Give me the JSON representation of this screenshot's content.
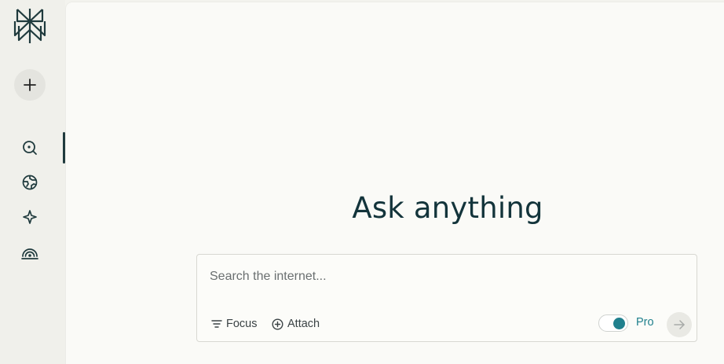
{
  "sidebar": {
    "logo_icon": "perplexity-logo-icon",
    "new_thread_icon": "plus-icon",
    "items": [
      {
        "id": "home",
        "icon": "search-icon",
        "active": true
      },
      {
        "id": "discover",
        "icon": "globe-icon",
        "active": false
      },
      {
        "id": "spaces",
        "icon": "sparkle-icon",
        "active": false
      },
      {
        "id": "library",
        "icon": "radar-icon",
        "active": false
      }
    ]
  },
  "main": {
    "headline": "Ask anything",
    "search": {
      "placeholder": "Search the internet...",
      "value": ""
    },
    "tools": {
      "focus_label": "Focus",
      "attach_label": "Attach"
    },
    "pro": {
      "label": "Pro",
      "enabled": true
    }
  },
  "colors": {
    "accent": "#20808d",
    "text_dark": "#13343b",
    "sidebar_bg": "#f0f0eb",
    "main_bg": "#fafaf7"
  }
}
